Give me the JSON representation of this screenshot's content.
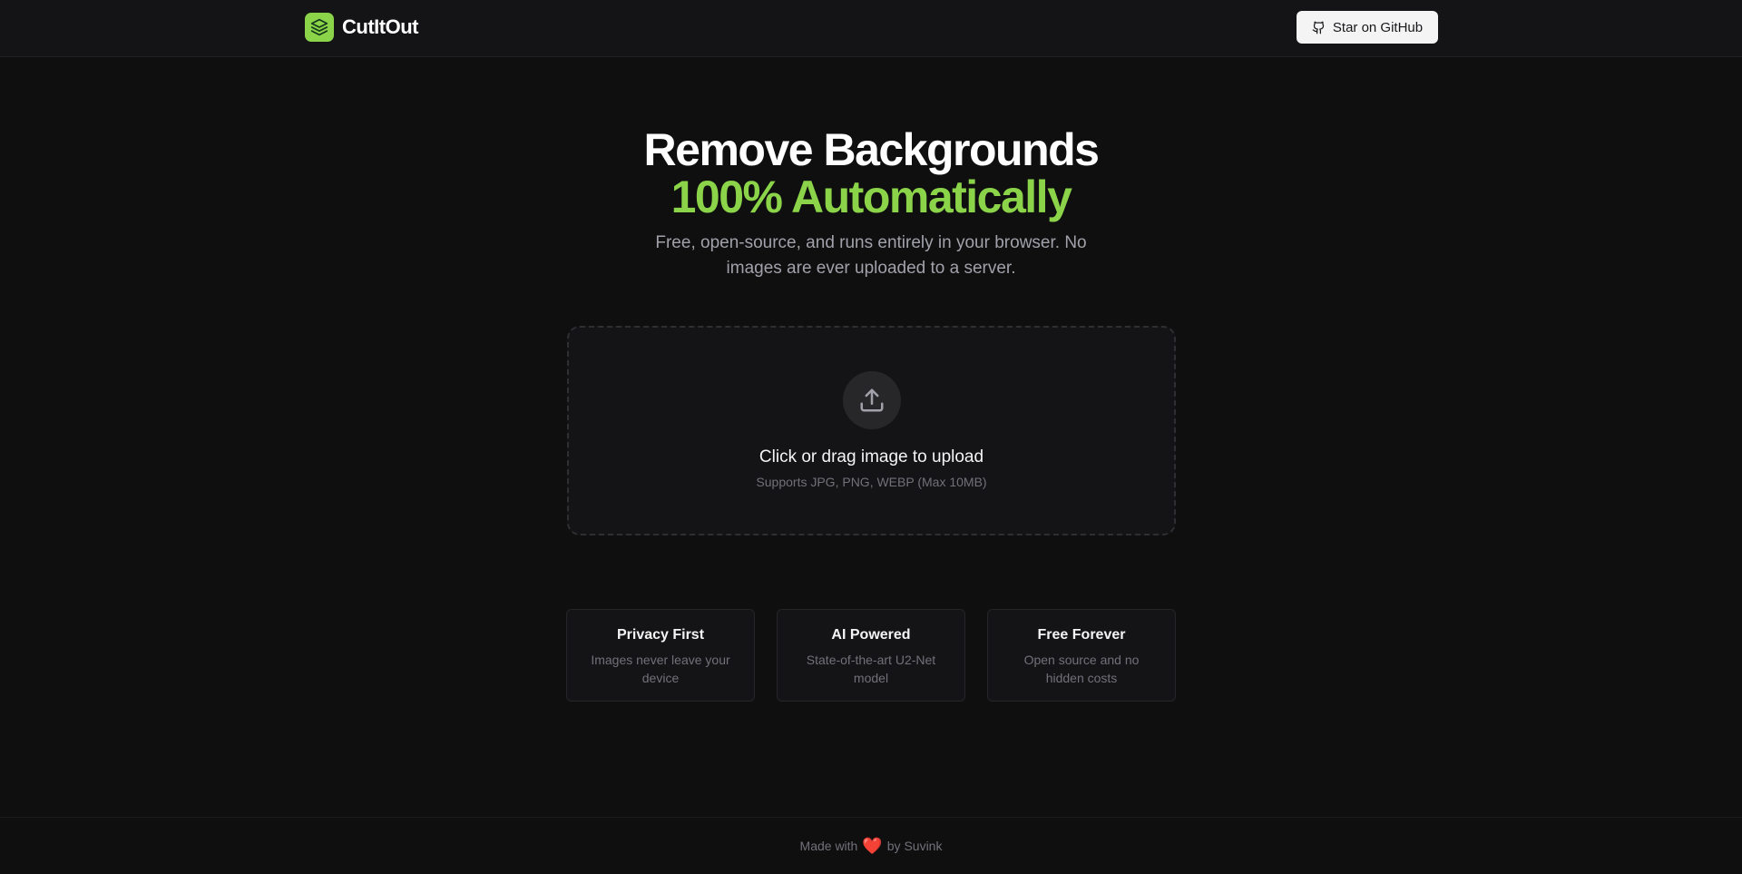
{
  "header": {
    "brand_name": "CutItOut",
    "github_label": "Star on GitHub"
  },
  "hero": {
    "title_line1": "Remove Backgrounds",
    "title_line2": "100% Automatically",
    "subtitle": "Free, open-source, and runs entirely in your browser. No images are ever uploaded to a server."
  },
  "upload": {
    "title": "Click or drag image to upload",
    "hint": "Supports JPG, PNG, WEBP (Max 10MB)",
    "icon": "upload-icon"
  },
  "features": [
    {
      "title": "Privacy First",
      "description": "Images never leave your device"
    },
    {
      "title": "AI Powered",
      "description": "State-of-the-art U2-Net model"
    },
    {
      "title": "Free Forever",
      "description": "Open source and no hidden costs"
    }
  ],
  "footer": {
    "made_with": "Made with",
    "heart": "❤️",
    "by": "by Suvink"
  },
  "colors": {
    "accent": "#8bd449",
    "background": "#0f0f10",
    "surface": "#141416"
  }
}
